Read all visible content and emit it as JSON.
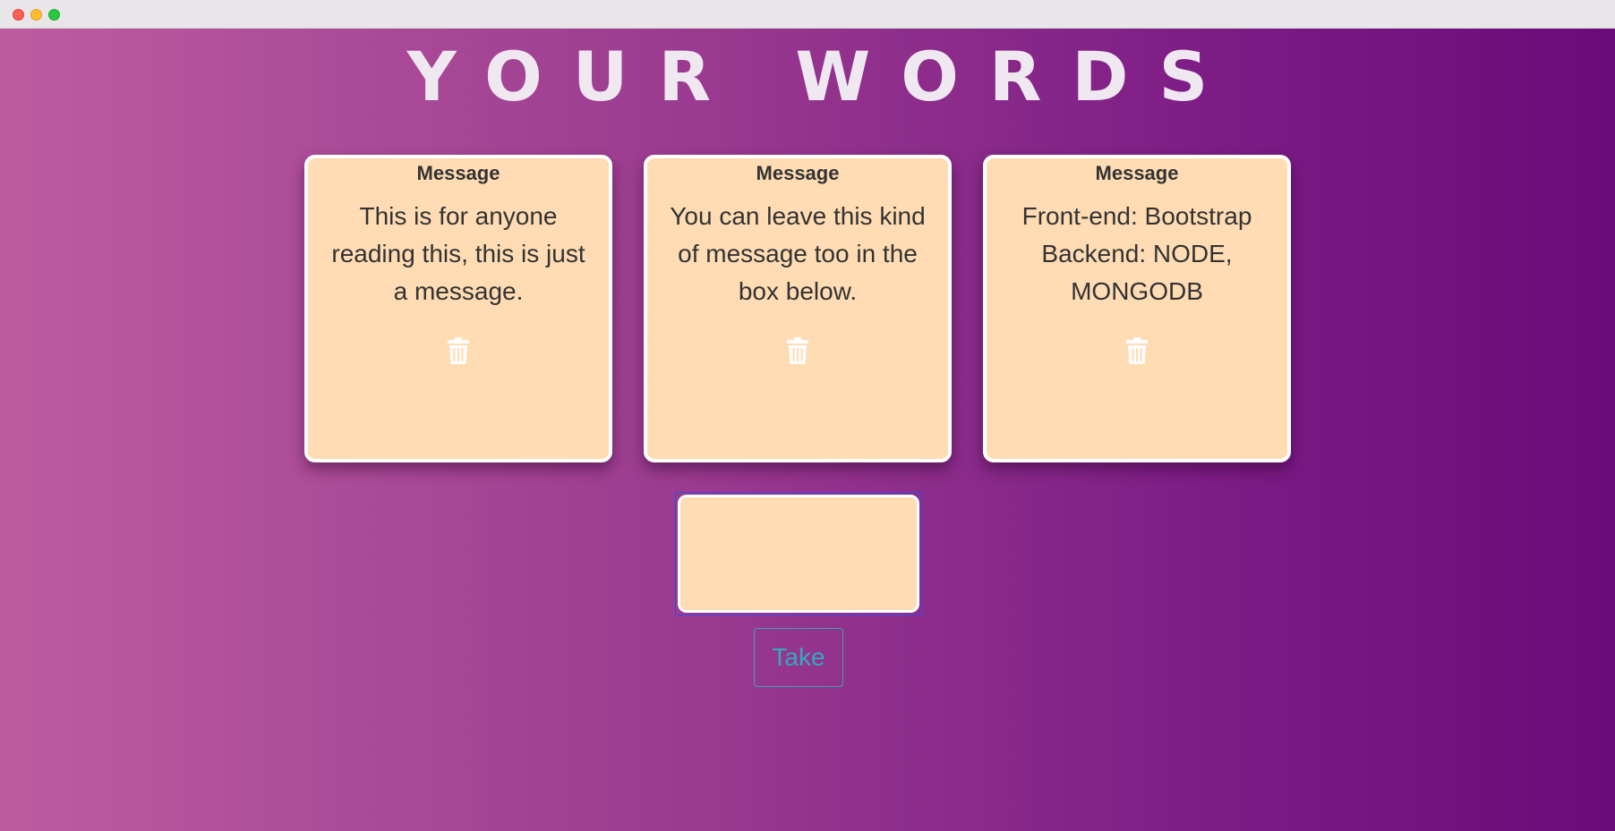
{
  "page": {
    "title": "YOUR WORDS"
  },
  "cards": [
    {
      "header": "Message",
      "body": "This is for anyone reading this, this is just a message.",
      "delete_icon": "trash-icon"
    },
    {
      "header": "Message",
      "body": "You can leave this kind of message too in the box below.",
      "delete_icon": "trash-icon"
    },
    {
      "header": "Message",
      "body": "Front-end: Bootstrap Backend: NODE, MONGODB",
      "delete_icon": "trash-icon"
    }
  ],
  "composer": {
    "value": ""
  },
  "take_button": {
    "label": "Take"
  },
  "colors": {
    "gradient_start": "#bd5c9f",
    "gradient_end": "#6a0b7a",
    "card_background": "#ffdcb4",
    "button_text": "#35a8bd"
  }
}
